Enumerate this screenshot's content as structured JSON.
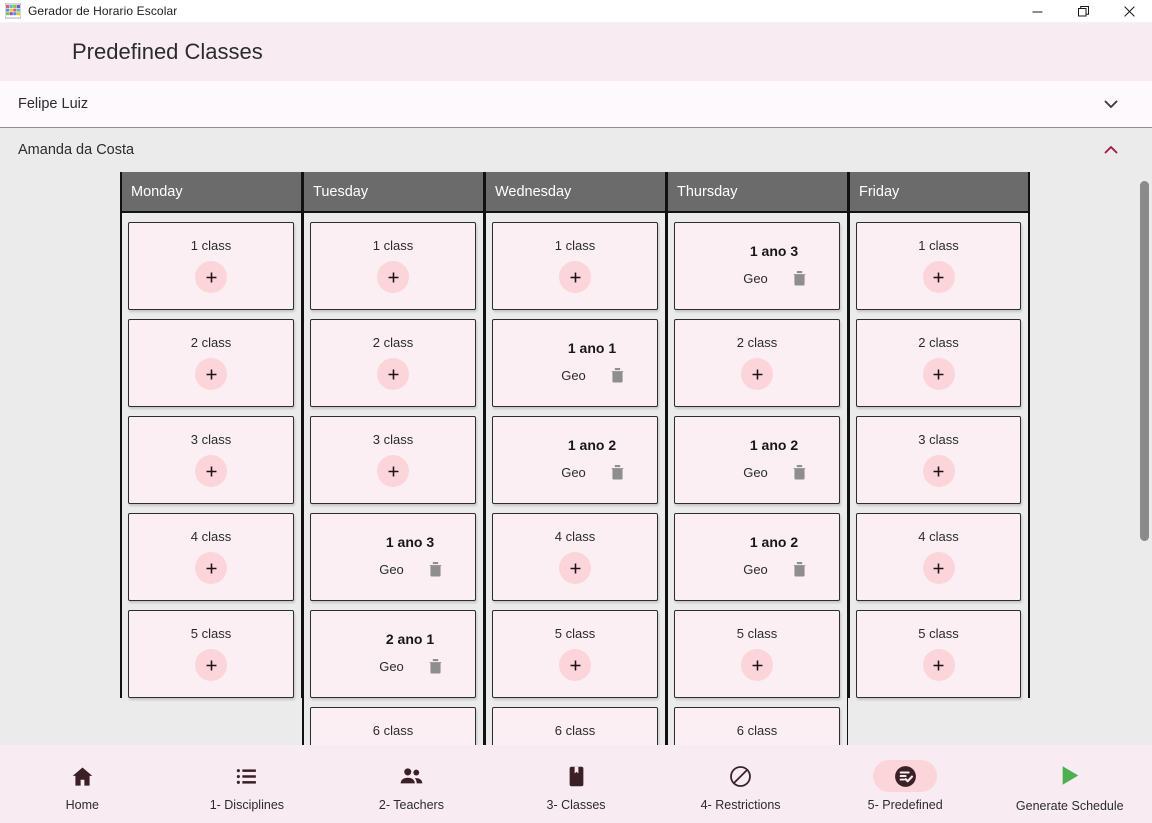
{
  "window": {
    "title": "Gerador de Horario Escolar",
    "app_icon": "table-grid-icon",
    "minimize_label": "Minimize",
    "maximize_label": "Maximize",
    "close_label": "Close"
  },
  "header": {
    "page_title": "Predefined Classes",
    "accent_pink": "#f8ecf2",
    "accent_chevron": "#9c1b3e"
  },
  "teachers": [
    {
      "name": "Felipe Luiz",
      "expanded": false,
      "chevron": "chevron-down-icon"
    },
    {
      "name": "Amanda da Costa",
      "expanded": true,
      "chevron": "chevron-up-icon"
    }
  ],
  "schedule": {
    "day_header_bg": "#6b6b6b",
    "slot_bg": "#fbeff4",
    "plus_circle_bg": "#fbd5da",
    "trash_color": "#8e8e8e",
    "columns": [
      {
        "day": "Monday",
        "slots": [
          {
            "type": "empty",
            "label": "1 class",
            "icon": "plus-icon"
          },
          {
            "type": "empty",
            "label": "2 class",
            "icon": "plus-icon"
          },
          {
            "type": "empty",
            "label": "3 class",
            "icon": "plus-icon"
          },
          {
            "type": "empty",
            "label": "4 class",
            "icon": "plus-icon"
          },
          {
            "type": "empty",
            "label": "5 class",
            "icon": "plus-icon"
          }
        ]
      },
      {
        "day": "Tuesday",
        "slots": [
          {
            "type": "empty",
            "label": "1 class",
            "icon": "plus-icon"
          },
          {
            "type": "empty",
            "label": "2 class",
            "icon": "plus-icon"
          },
          {
            "type": "empty",
            "label": "3 class",
            "icon": "plus-icon"
          },
          {
            "type": "filled",
            "title": "1 ano 3",
            "subject": "Geo",
            "icon": "trash-icon"
          },
          {
            "type": "filled",
            "title": "2 ano 1",
            "subject": "Geo",
            "icon": "trash-icon"
          },
          {
            "type": "empty",
            "label": "6 class",
            "icon": "plus-icon"
          }
        ]
      },
      {
        "day": "Wednesday",
        "slots": [
          {
            "type": "empty",
            "label": "1 class",
            "icon": "plus-icon"
          },
          {
            "type": "filled",
            "title": "1 ano 1",
            "subject": "Geo",
            "icon": "trash-icon"
          },
          {
            "type": "filled",
            "title": "1 ano 2",
            "subject": "Geo",
            "icon": "trash-icon"
          },
          {
            "type": "empty",
            "label": "4 class",
            "icon": "plus-icon"
          },
          {
            "type": "empty",
            "label": "5 class",
            "icon": "plus-icon"
          },
          {
            "type": "empty",
            "label": "6 class",
            "icon": "plus-icon"
          }
        ]
      },
      {
        "day": "Thursday",
        "slots": [
          {
            "type": "filled",
            "title": "1 ano 3",
            "subject": "Geo",
            "icon": "trash-icon"
          },
          {
            "type": "empty",
            "label": "2 class",
            "icon": "plus-icon"
          },
          {
            "type": "filled",
            "title": "1 ano 2",
            "subject": "Geo",
            "icon": "trash-icon"
          },
          {
            "type": "filled",
            "title": "1 ano 2",
            "subject": "Geo",
            "icon": "trash-icon"
          },
          {
            "type": "empty",
            "label": "5 class",
            "icon": "plus-icon"
          },
          {
            "type": "empty",
            "label": "6 class",
            "icon": "plus-icon"
          }
        ]
      },
      {
        "day": "Friday",
        "slots": [
          {
            "type": "empty",
            "label": "1 class",
            "icon": "plus-icon"
          },
          {
            "type": "empty",
            "label": "2 class",
            "icon": "plus-icon"
          },
          {
            "type": "empty",
            "label": "3 class",
            "icon": "plus-icon"
          },
          {
            "type": "empty",
            "label": "4 class",
            "icon": "plus-icon"
          },
          {
            "type": "empty",
            "label": "5 class",
            "icon": "plus-icon"
          }
        ]
      }
    ]
  },
  "bottom_nav": {
    "items": [
      {
        "label": "Home",
        "icon": "home-icon",
        "active": false
      },
      {
        "label": "1- Disciplines",
        "icon": "list-icon",
        "active": false
      },
      {
        "label": "2- Teachers",
        "icon": "people-icon",
        "active": false
      },
      {
        "label": "3- Classes",
        "icon": "book-icon",
        "active": false
      },
      {
        "label": "4- Restrictions",
        "icon": "block-icon",
        "active": false
      },
      {
        "label": "5- Predefined",
        "icon": "note-check-icon",
        "active": true
      },
      {
        "label": "Generate Schedule",
        "icon": "play-icon",
        "active": false,
        "color": "#4caf50"
      }
    ]
  }
}
